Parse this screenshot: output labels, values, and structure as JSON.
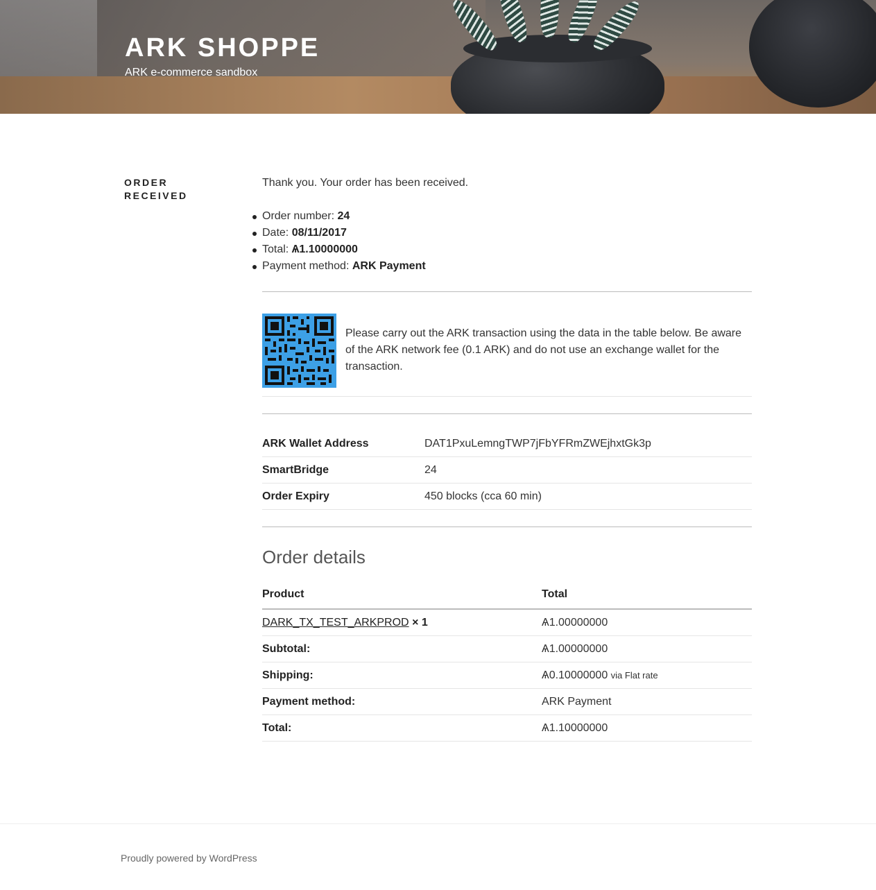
{
  "header": {
    "site_title": "ARK SHOPPE",
    "site_description": "ARK e-commerce sandbox"
  },
  "page": {
    "title": "ORDER RECEIVED"
  },
  "order": {
    "thank_you": "Thank you. Your order has been received.",
    "overview": [
      {
        "label": "Order number:",
        "value": "24"
      },
      {
        "label": "Date:",
        "value": "08/11/2017"
      },
      {
        "label": "Total:",
        "value": "Ѧ1.10000000"
      },
      {
        "label": "Payment method:",
        "value": "ARK Payment"
      }
    ]
  },
  "payment": {
    "instructions": "Please carry out the ARK transaction using the data in the table below. Be aware of the ARK network fee (0.1 ARK) and do not use an exchange wallet for the transaction.",
    "rows": [
      {
        "label": "ARK Wallet Address",
        "value": "DAT1PxuLemngTWP7jFbYFRmZWEjhxtGk3p"
      },
      {
        "label": "SmartBridge",
        "value": "24"
      },
      {
        "label": "Order Expiry",
        "value": "450 blocks (cca 60 min)"
      }
    ]
  },
  "order_details": {
    "heading": "Order details",
    "col_product": "Product",
    "col_total": "Total",
    "item": {
      "name": "DARK_TX_TEST_ARKPROD",
      "qty": "× 1",
      "total": "Ѧ1.00000000"
    },
    "subtotal": {
      "label": "Subtotal:",
      "value": "Ѧ1.00000000"
    },
    "shipping": {
      "label": "Shipping:",
      "value": "Ѧ0.10000000",
      "via": "via Flat rate"
    },
    "payment_method": {
      "label": "Payment method:",
      "value": "ARK Payment"
    },
    "total": {
      "label": "Total:",
      "value": "Ѧ1.10000000"
    }
  },
  "footer": {
    "text": "Proudly powered by WordPress"
  },
  "colors": {
    "qr_background": "#3da0e6"
  }
}
